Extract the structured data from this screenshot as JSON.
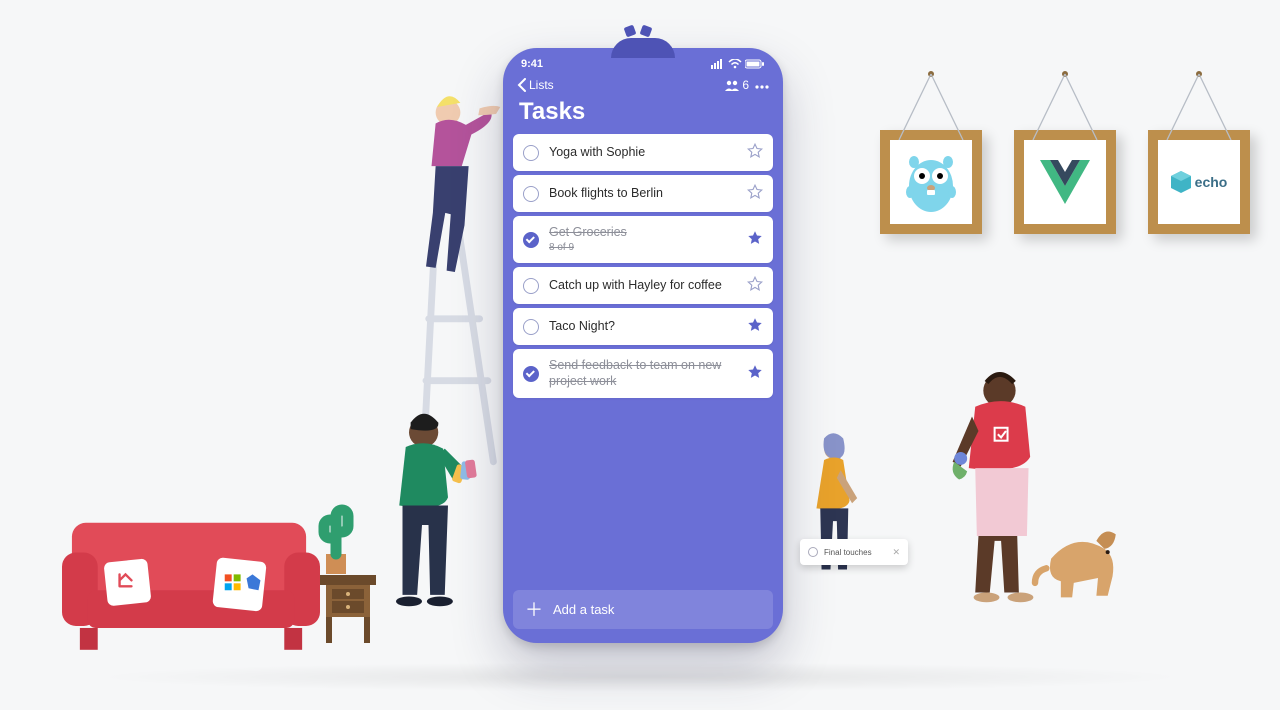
{
  "status_bar": {
    "time": "9:41"
  },
  "nav": {
    "back_label": "Lists",
    "share_count": "6"
  },
  "title": "Tasks",
  "tasks": [
    {
      "label": "Yoga with Sophie",
      "done": false,
      "starred": false
    },
    {
      "label": "Book flights to Berlin",
      "done": false,
      "starred": false
    },
    {
      "label": "Get Groceries",
      "sub": "8 of 9",
      "done": true,
      "starred": true
    },
    {
      "label": "Catch up with Hayley for coffee",
      "done": false,
      "starred": false
    },
    {
      "label": "Taco Night?",
      "done": false,
      "starred": true
    },
    {
      "label": "Send feedback to team on new project work",
      "done": true,
      "starred": true
    }
  ],
  "add_task_label": "Add a task",
  "floating_chip": {
    "label": "Final touches"
  },
  "frames": {
    "go": {
      "alt": "Go gopher"
    },
    "vue": {
      "alt": "Vue.js"
    },
    "echo": {
      "label": "echo"
    }
  },
  "colors": {
    "phone_bg": "#6a6fd6",
    "accent": "#5b63c9"
  }
}
